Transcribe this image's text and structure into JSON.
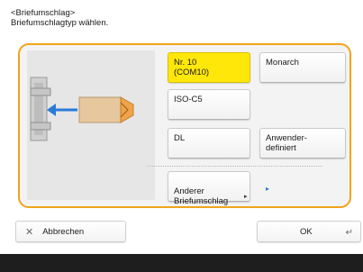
{
  "header": {
    "title": "<Briefumschlag>",
    "instruction": "Briefumschlagtyp wählen."
  },
  "options": [
    {
      "label": "Nr. 10\n(COM10)",
      "selected": true
    },
    {
      "label": "Monarch",
      "selected": false
    },
    {
      "label": "ISO-C5",
      "selected": false
    },
    {
      "label": "DL",
      "selected": false
    },
    {
      "label": "Anwender-\ndefiniert",
      "selected": false
    },
    {
      "label": "Anderer\nBriefumschlag",
      "selected": false
    }
  ],
  "footer": {
    "cancel_label": "Abbrechen",
    "ok_label": "OK"
  },
  "colors": {
    "selected": "#ffe70a",
    "panel_border": "#f0a41c",
    "arrow": "#2a7bd8"
  },
  "icons": {
    "cancel": "close-icon",
    "ok": "return-arrow-icon",
    "more": "chevron-right-icon"
  }
}
